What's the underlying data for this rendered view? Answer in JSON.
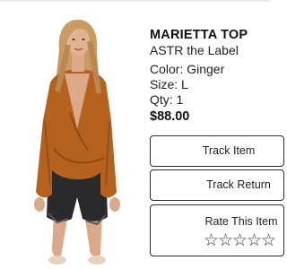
{
  "product": {
    "name": "MARIETTA TOP",
    "brand": "ASTR the Label",
    "color_line": "Color: Ginger",
    "size_line": "Size: L",
    "qty_line": "Qty: 1",
    "price": "$88.00"
  },
  "actions": {
    "track_item_label": "Track Item",
    "track_return_label": "Track Return",
    "rate_label": "Rate This Item"
  },
  "rating": {
    "max": 5,
    "value": 0,
    "star_glyph": "☆"
  },
  "colors": {
    "accent_border": "#2b2b2b",
    "text": "#111111",
    "top_color": "#b5621f"
  }
}
